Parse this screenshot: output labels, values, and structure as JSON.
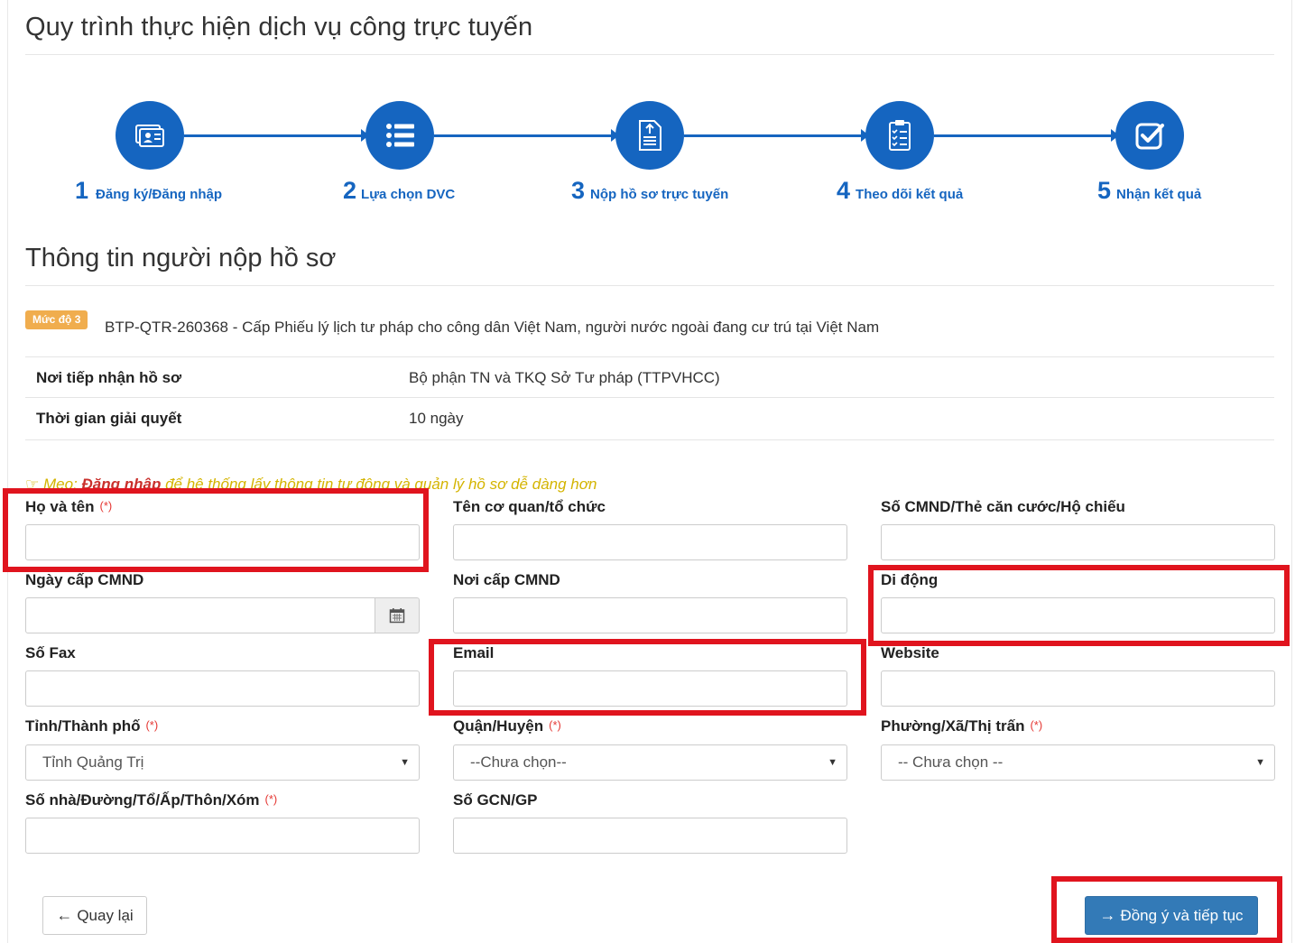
{
  "header": {
    "title": "Quy trình thực hiện dịch vụ công trực tuyến"
  },
  "steps": [
    {
      "num": "1",
      "label": "Đăng ký/Đăng nhập",
      "icon": "id-card-icon"
    },
    {
      "num": "2",
      "label": "Lựa chọn DVC",
      "icon": "list-icon"
    },
    {
      "num": "3",
      "label": "Nộp hồ sơ trực tuyến",
      "icon": "document-upload-icon"
    },
    {
      "num": "4",
      "label": "Theo dõi kết quả",
      "icon": "clipboard-checklist-icon"
    },
    {
      "num": "5",
      "label": "Nhận kết quả",
      "icon": "check-square-icon"
    }
  ],
  "section": {
    "title": "Thông tin người nộp hồ sơ",
    "badge": "Mức độ 3",
    "procedure": "BTP-QTR-260368 - Cấp Phiếu lý lịch tư pháp cho công dân Việt Nam, người nước ngoài đang cư trú tại Việt Nam",
    "info": [
      {
        "key": "Nơi tiếp nhận hồ sơ",
        "value": "Bộ phận TN và TKQ Sở Tư pháp (TTPVHCC)"
      },
      {
        "key": "Thời gian giải quyết",
        "value": "10 ngày"
      }
    ],
    "tip_prefix": "Mẹo: ",
    "tip_link": "Đăng nhập",
    "tip_rest": " để hệ thống lấy thông tin tự động và quản lý hồ sơ dễ dàng hơn"
  },
  "form": {
    "required_mark": "(*)",
    "ho_ten": {
      "label": "Họ và tên",
      "value": ""
    },
    "co_quan": {
      "label": "Tên cơ quan/tổ chức",
      "value": ""
    },
    "cmnd": {
      "label": "Số CMND/Thẻ căn cước/Hộ chiếu",
      "value": ""
    },
    "ngay_cap": {
      "label": "Ngày cấp CMND",
      "value": ""
    },
    "noi_cap": {
      "label": "Nơi cấp CMND",
      "value": ""
    },
    "di_dong": {
      "label": "Di động",
      "value": ""
    },
    "fax": {
      "label": "Số Fax",
      "value": ""
    },
    "email": {
      "label": "Email",
      "value": ""
    },
    "website": {
      "label": "Website",
      "value": ""
    },
    "tinh": {
      "label": "Tỉnh/Thành phố",
      "selected": "Tỉnh Quảng Trị"
    },
    "quan": {
      "label": "Quận/Huyện",
      "selected": "--Chưa chọn--"
    },
    "phuong": {
      "label": "Phường/Xã/Thị trấn",
      "selected": "-- Chưa chọn --"
    },
    "so_nha": {
      "label": "Số nhà/Đường/Tổ/Ấp/Thôn/Xóm",
      "value": ""
    },
    "gcn": {
      "label": "Số GCN/GP",
      "value": ""
    }
  },
  "actions": {
    "back_label": "Quay lại",
    "next_label": "Đồng ý và tiếp tục"
  },
  "colors": {
    "primary": "#1565c0",
    "button": "#337ab7",
    "badge": "#f0ad4e",
    "highlight": "#e0141e",
    "tip": "#d4b400"
  }
}
